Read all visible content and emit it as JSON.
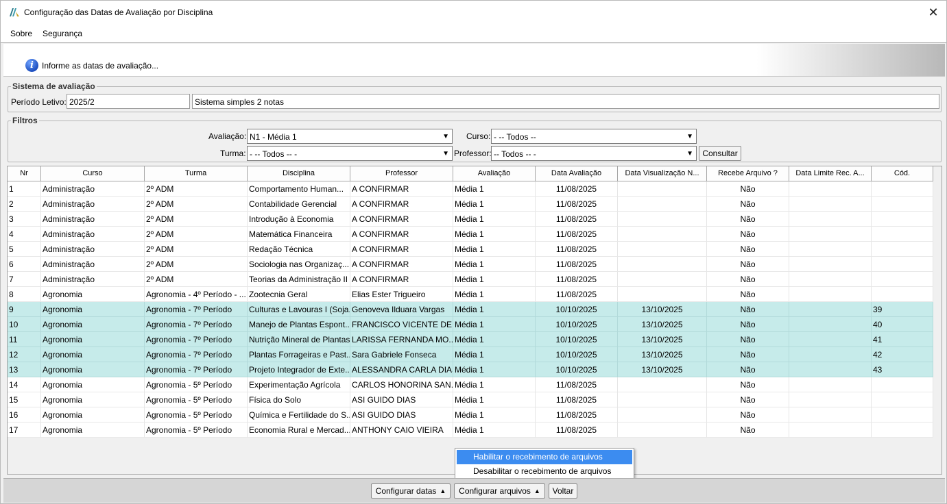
{
  "window": {
    "title": "Configuração das Datas de Avaliação por Disciplina",
    "close_glyph": "✕",
    "icon": "app-logo-icon"
  },
  "menu": [
    "Sobre",
    "Segurança"
  ],
  "banner": {
    "icon": "info-icon",
    "icon_glyph": "i",
    "text": "Informe as datas de avaliação..."
  },
  "sistema": {
    "legend": "Sistema de avaliação",
    "periodo_label": "Período Letivo:",
    "periodo_value": "2025/2",
    "sistema_value": "Sistema simples 2 notas"
  },
  "filtros": {
    "legend": "Filtros",
    "avaliacao_label": "Avaliação:",
    "avaliacao_value": "N1 - Média 1",
    "curso_label": "Curso:",
    "curso_value": "- -- Todos --",
    "turma_label": "Turma:",
    "turma_value": "- -- Todos -- -",
    "professor_label": "Professor:",
    "professor_value": "-- Todos -- -",
    "consultar_label": "Consultar"
  },
  "table": {
    "columns": [
      "Nr",
      "Curso",
      "Turma",
      "Disciplina",
      "Professor",
      "Avaliação",
      "Data Avaliação",
      "Data Visualização N...",
      "Recebe Arquivo ?",
      "Data Limite Rec. A...",
      "Cód."
    ],
    "rows": [
      {
        "nr": "1",
        "curso": "Administração",
        "turma": "2º ADM",
        "disciplina": "Comportamento Human...",
        "professor": "A CONFIRMAR",
        "avaliacao": "Média 1",
        "data_av": "11/08/2025",
        "data_vis": "",
        "recebe": "Não",
        "data_lim": "",
        "cod": "",
        "hl": false
      },
      {
        "nr": "2",
        "curso": "Administração",
        "turma": "2º ADM",
        "disciplina": "Contabilidade Gerencial",
        "professor": "A CONFIRMAR",
        "avaliacao": "Média 1",
        "data_av": "11/08/2025",
        "data_vis": "",
        "recebe": "Não",
        "data_lim": "",
        "cod": "",
        "hl": false
      },
      {
        "nr": "3",
        "curso": "Administração",
        "turma": "2º ADM",
        "disciplina": "Introdução à Economia",
        "professor": "A CONFIRMAR",
        "avaliacao": "Média 1",
        "data_av": "11/08/2025",
        "data_vis": "",
        "recebe": "Não",
        "data_lim": "",
        "cod": "",
        "hl": false
      },
      {
        "nr": "4",
        "curso": "Administração",
        "turma": "2º ADM",
        "disciplina": "Matemática Financeira",
        "professor": "A CONFIRMAR",
        "avaliacao": "Média 1",
        "data_av": "11/08/2025",
        "data_vis": "",
        "recebe": "Não",
        "data_lim": "",
        "cod": "",
        "hl": false
      },
      {
        "nr": "5",
        "curso": "Administração",
        "turma": "2º ADM",
        "disciplina": "Redação Técnica",
        "professor": "A CONFIRMAR",
        "avaliacao": "Média 1",
        "data_av": "11/08/2025",
        "data_vis": "",
        "recebe": "Não",
        "data_lim": "",
        "cod": "",
        "hl": false
      },
      {
        "nr": "6",
        "curso": "Administração",
        "turma": "2º ADM",
        "disciplina": "Sociologia nas Organizaç...",
        "professor": "A CONFIRMAR",
        "avaliacao": "Média 1",
        "data_av": "11/08/2025",
        "data_vis": "",
        "recebe": "Não",
        "data_lim": "",
        "cod": "",
        "hl": false
      },
      {
        "nr": "7",
        "curso": "Administração",
        "turma": "2º ADM",
        "disciplina": "Teorias da Administração II",
        "professor": "A CONFIRMAR",
        "avaliacao": "Média 1",
        "data_av": "11/08/2025",
        "data_vis": "",
        "recebe": "Não",
        "data_lim": "",
        "cod": "",
        "hl": false
      },
      {
        "nr": "8",
        "curso": "Agronomia",
        "turma": "Agronomia - 4º Período - ...",
        "disciplina": "Zootecnia Geral",
        "professor": "Elias Ester Trigueiro",
        "avaliacao": "Média 1",
        "data_av": "11/08/2025",
        "data_vis": "",
        "recebe": "Não",
        "data_lim": "",
        "cod": "",
        "hl": false
      },
      {
        "nr": "9",
        "curso": "Agronomia",
        "turma": "Agronomia - 7º Período",
        "disciplina": "Culturas e Lavouras I (Soja...",
        "professor": "Genoveva Ilduara Vargas",
        "avaliacao": "Média 1",
        "data_av": "10/10/2025",
        "data_vis": "13/10/2025",
        "recebe": "Não",
        "data_lim": "",
        "cod": "39",
        "hl": true
      },
      {
        "nr": "10",
        "curso": "Agronomia",
        "turma": "Agronomia - 7º Período",
        "disciplina": "Manejo de Plantas Espont...",
        "professor": "FRANCISCO VICENTE DE L...",
        "avaliacao": "Média 1",
        "data_av": "10/10/2025",
        "data_vis": "13/10/2025",
        "recebe": "Não",
        "data_lim": "",
        "cod": "40",
        "hl": true
      },
      {
        "nr": "11",
        "curso": "Agronomia",
        "turma": "Agronomia - 7º Período",
        "disciplina": "Nutrição Mineral de Plantas",
        "professor": "LARISSA FERNANDA MO...",
        "avaliacao": "Média 1",
        "data_av": "10/10/2025",
        "data_vis": "13/10/2025",
        "recebe": "Não",
        "data_lim": "",
        "cod": "41",
        "hl": true
      },
      {
        "nr": "12",
        "curso": "Agronomia",
        "turma": "Agronomia - 7º Período",
        "disciplina": "Plantas Forrageiras e Past...",
        "professor": "Sara Gabriele Fonseca",
        "avaliacao": "Média 1",
        "data_av": "10/10/2025",
        "data_vis": "13/10/2025",
        "recebe": "Não",
        "data_lim": "",
        "cod": "42",
        "hl": true
      },
      {
        "nr": "13",
        "curso": "Agronomia",
        "turma": "Agronomia - 7º Período",
        "disciplina": "Projeto Integrador de Exte...",
        "professor": "ALESSANDRA CARLA DIAS",
        "avaliacao": "Média 1",
        "data_av": "10/10/2025",
        "data_vis": "13/10/2025",
        "recebe": "Não",
        "data_lim": "",
        "cod": "43",
        "hl": true
      },
      {
        "nr": "14",
        "curso": "Agronomia",
        "turma": "Agronomia - 5º Período",
        "disciplina": "Experimentação Agrícola",
        "professor": "CARLOS HONORINA SAN...",
        "avaliacao": "Média 1",
        "data_av": "11/08/2025",
        "data_vis": "",
        "recebe": "Não",
        "data_lim": "",
        "cod": "",
        "hl": false
      },
      {
        "nr": "15",
        "curso": "Agronomia",
        "turma": "Agronomia - 5º Período",
        "disciplina": "Física do Solo",
        "professor": "ASI GUIDO DIAS",
        "avaliacao": "Média 1",
        "data_av": "11/08/2025",
        "data_vis": "",
        "recebe": "Não",
        "data_lim": "",
        "cod": "",
        "hl": false
      },
      {
        "nr": "16",
        "curso": "Agronomia",
        "turma": "Agronomia - 5º Período",
        "disciplina": "Química e Fertilidade do S...",
        "professor": "ASI GUIDO DIAS",
        "avaliacao": "Média 1",
        "data_av": "11/08/2025",
        "data_vis": "",
        "recebe": "Não",
        "data_lim": "",
        "cod": "",
        "hl": false
      },
      {
        "nr": "17",
        "curso": "Agronomia",
        "turma": "Agronomia - 5º Período",
        "disciplina": "Economia Rural e Mercad...",
        "professor": "ANTHONY CAIO VIEIRA",
        "avaliacao": "Média 1",
        "data_av": "11/08/2025",
        "data_vis": "",
        "recebe": "Não",
        "data_lim": "",
        "cod": "",
        "hl": false
      }
    ]
  },
  "popup_menu": {
    "items": [
      "Habilitar o recebimento de arquivos",
      "Desabilitar o recebimento de arquivos"
    ],
    "selected_index": 0
  },
  "bottom": {
    "configurar_datas_label": "Configurar datas",
    "configurar_arquivos_label": "Configurar arquivos",
    "voltar_label": "Voltar",
    "dropdown_glyph": "▲"
  },
  "colors": {
    "highlight_row": "#c6ebea",
    "popup_selected": "#3c8cf0"
  }
}
